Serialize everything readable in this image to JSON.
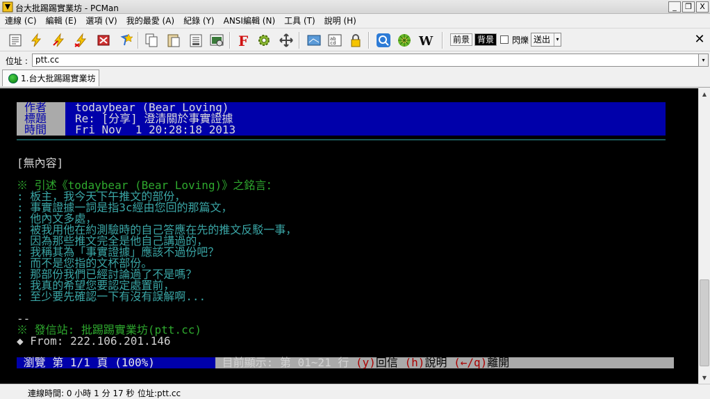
{
  "window": {
    "title": "台大批踢踢實業坊 - PCMan",
    "buttons": {
      "minimize": "_",
      "restore": "❐",
      "close": "X"
    }
  },
  "menu": [
    "連線 (C)",
    "編輯 (E)",
    "選項 (V)",
    "我的最愛 (A)",
    "紀錄 (Y)",
    "ANSI編輯 (N)",
    "工具 (T)",
    "說明 (H)"
  ],
  "toolbar": {
    "icons": [
      "site-list-icon",
      "connect-icon",
      "quick-connect-icon",
      "reconnect-icon",
      "disconnect-icon",
      "add-favorite-icon",
      "copy-icon",
      "paste-icon",
      "copy-with-ansi-icon",
      "screenshot-icon",
      "font-icon",
      "settings-icon",
      "fullscreen-icon",
      "view-icon",
      "nav-icon",
      "lock-icon",
      "search-icon",
      "emoticon-icon",
      "wikipedia-icon"
    ],
    "fg_label": "前景",
    "bg_label": "背景",
    "blink_label": "閃爍",
    "send_label": "送出",
    "send_arrow": "▾",
    "close_label": "✕"
  },
  "address": {
    "label": "位址 :",
    "value": "ptt.cc",
    "dropdown": "▾"
  },
  "tab": {
    "label": "1.台大批踢踢實業坊"
  },
  "terminal": {
    "header": {
      "author_label": "作者",
      "author": "todaybear (Bear Loving)",
      "title_label": "標題",
      "title": "Re: [分享] 澄清關於事實證據",
      "time_label": "時間",
      "time": "Fri Nov  1 20:28:18 2013"
    },
    "body": "[無內容]",
    "cite": "※ 引述《todaybear (Bear Loving)》之銘言：",
    "quotes": [
      ": 板主，我今天下午推文的部份，",
      ": 事實證據一詞是指3c經由您回的那篇文，",
      ": 他內文多處，",
      ": 被我用他在約測驗時的自己答應在先的推文反駁一事，",
      ": 因為那些推文完全是他自己講過的，",
      ": 我稱其為「事實證據」應該不過份吧？",
      ": 而不是您指的文杯部份。",
      ": 那部份我們已經討論過了不是嗎？",
      ": 我真的希望您要認定處置前，",
      ": 至少要先確認一下有沒有誤解啊..."
    ],
    "sig_dash": "--",
    "sig_site": "※ 發信站: 批踢踢實業坊(ptt.cc)",
    "sig_from": "◆ From: 222.106.201.146",
    "status": {
      "browse": " 瀏覽 第 1/1 頁 (100%) ",
      "display": " 目前顯示: 第 01~21 行 ",
      "reply_key": "(y)",
      "reply": "回信",
      "help_key": "(h)",
      "help": "說明",
      "leave_key": "(←/q)",
      "leave": "離開"
    }
  },
  "scrollbar": {
    "up": "▲",
    "down": "▼"
  },
  "footer": {
    "connection_time": "連線時間: 0 小時 1 分 17 秒",
    "address": "位址:ptt.cc"
  }
}
